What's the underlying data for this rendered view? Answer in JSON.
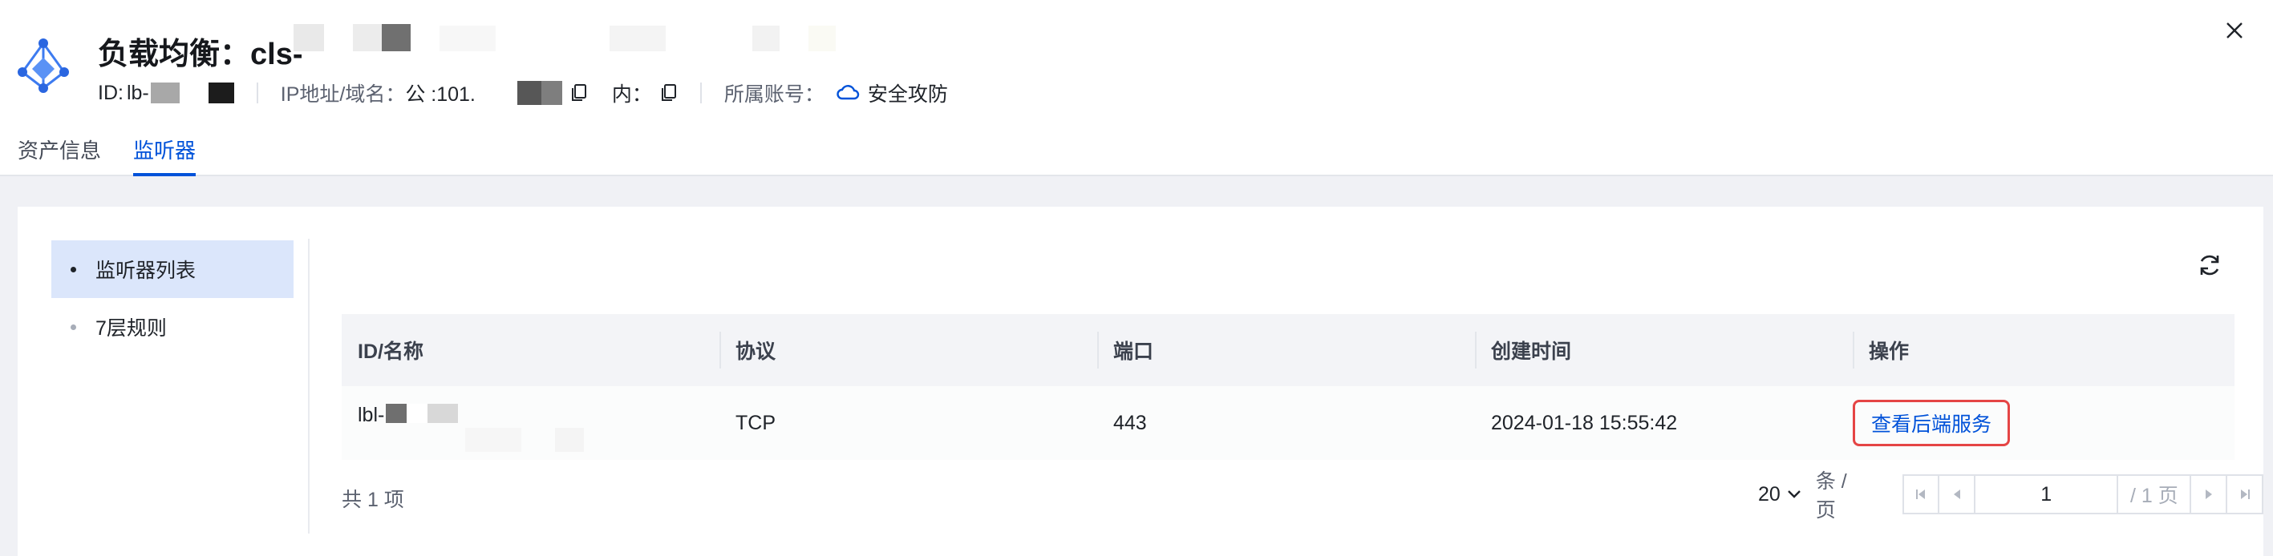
{
  "header": {
    "title": "负载均衡：cls-",
    "id_label": "ID:",
    "id_value": "lb-",
    "ip_label": "IP地址/域名：",
    "ip_public": "公 :101.",
    "ip_private": "内：",
    "account_label": "所属账号：",
    "account_value": "安全攻防",
    "icons": {
      "logo": "load-balancer-logo",
      "copy": "copy-icon",
      "cloud": "cloud-icon",
      "close": "close-icon"
    }
  },
  "tabs": [
    {
      "label": "资产信息",
      "active": false
    },
    {
      "label": "监听器",
      "active": true
    }
  ],
  "side_nav": [
    {
      "label": "监听器列表",
      "active": true
    },
    {
      "label": "7层规则",
      "active": false
    }
  ],
  "table": {
    "columns": [
      "ID/名称",
      "协议",
      "端口",
      "创建时间",
      "操作"
    ],
    "rows": [
      {
        "id": "lbl-",
        "protocol": "TCP",
        "port": "443",
        "created": "2024-01-18 15:55:42",
        "action": "查看后端服务"
      }
    ]
  },
  "pagination": {
    "total_text": "共 1 项",
    "page_size": "20",
    "per_page_text": "条 / 页",
    "current_page": "1",
    "total_pages_text": "/ 1 页"
  },
  "colors": {
    "accent": "#0052d9",
    "highlight": "#e54545",
    "active_bg": "#dbe6fb"
  }
}
